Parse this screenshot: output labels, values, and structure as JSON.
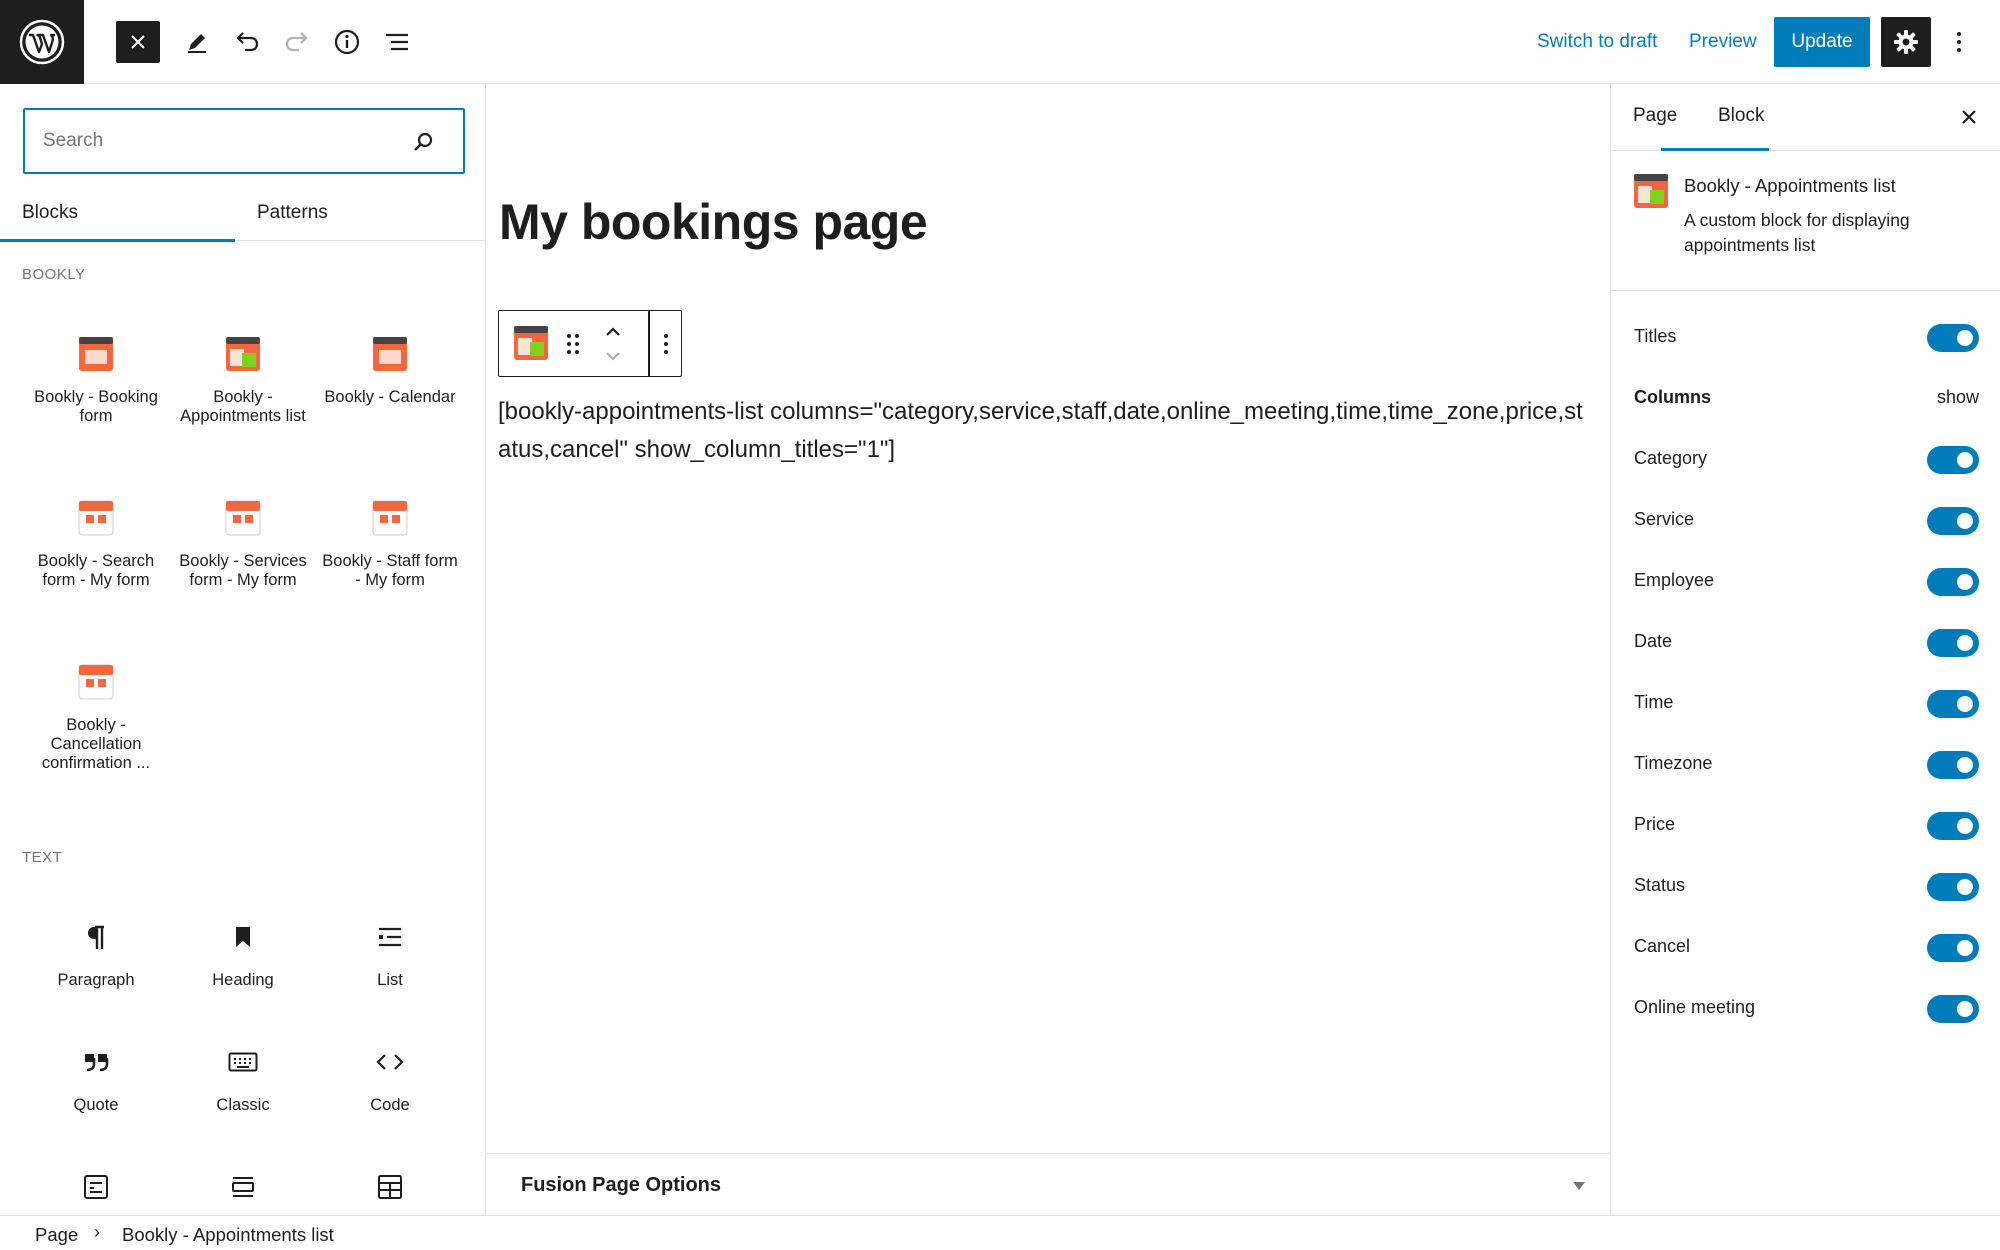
{
  "topbar": {
    "switch_to_draft": "Switch to draft",
    "preview": "Preview",
    "update": "Update"
  },
  "inserter": {
    "search_placeholder": "Search",
    "tabs": [
      "Blocks",
      "Patterns"
    ],
    "categories": {
      "bookly": "BOOKLY",
      "text": "TEXT"
    },
    "bookly_blocks": [
      {
        "label": "Bookly - Booking form"
      },
      {
        "label": "Bookly - Appointments list"
      },
      {
        "label": "Bookly - Calendar"
      },
      {
        "label": "Bookly - Search form - My form"
      },
      {
        "label": "Bookly - Services form - My form"
      },
      {
        "label": "Bookly - Staff form - My form"
      },
      {
        "label": "Bookly - Cancellation confirmation ..."
      }
    ],
    "text_blocks": [
      {
        "label": "Paragraph"
      },
      {
        "label": "Heading"
      },
      {
        "label": "List"
      },
      {
        "label": "Quote"
      },
      {
        "label": "Classic"
      },
      {
        "label": "Code"
      }
    ]
  },
  "canvas": {
    "title": "My bookings page",
    "shortcode": "[bookly-appointments-list columns=\"category,service,staff,date,online_meeting,time,time_zone,price,status,cancel\" show_column_titles=\"1\"]",
    "fusion_options": "Fusion Page Options"
  },
  "sidebar": {
    "tabs": [
      "Page",
      "Block"
    ],
    "block_title": "Bookly - Appointments list",
    "block_description": "A custom block for displaying appointments list",
    "settings": [
      {
        "label": "Titles",
        "type": "toggle",
        "on": true
      },
      {
        "label": "Columns",
        "type": "header",
        "value": "show"
      },
      {
        "label": "Category",
        "type": "toggle",
        "on": true
      },
      {
        "label": "Service",
        "type": "toggle",
        "on": true
      },
      {
        "label": "Employee",
        "type": "toggle",
        "on": true
      },
      {
        "label": "Date",
        "type": "toggle",
        "on": true
      },
      {
        "label": "Time",
        "type": "toggle",
        "on": true
      },
      {
        "label": "Timezone",
        "type": "toggle",
        "on": true
      },
      {
        "label": "Price",
        "type": "toggle",
        "on": true
      },
      {
        "label": "Status",
        "type": "toggle",
        "on": true
      },
      {
        "label": "Cancel",
        "type": "toggle",
        "on": true
      },
      {
        "label": "Online meeting",
        "type": "toggle",
        "on": true
      }
    ]
  },
  "breadcrumb": {
    "items": [
      "Page",
      "Bookly - Appointments list"
    ],
    "separator": "›"
  },
  "colors": {
    "accent": "#007cba",
    "dark": "#1e1e1e",
    "bookly_orange": "#f4663b",
    "bookly_green": "#7ed321"
  }
}
